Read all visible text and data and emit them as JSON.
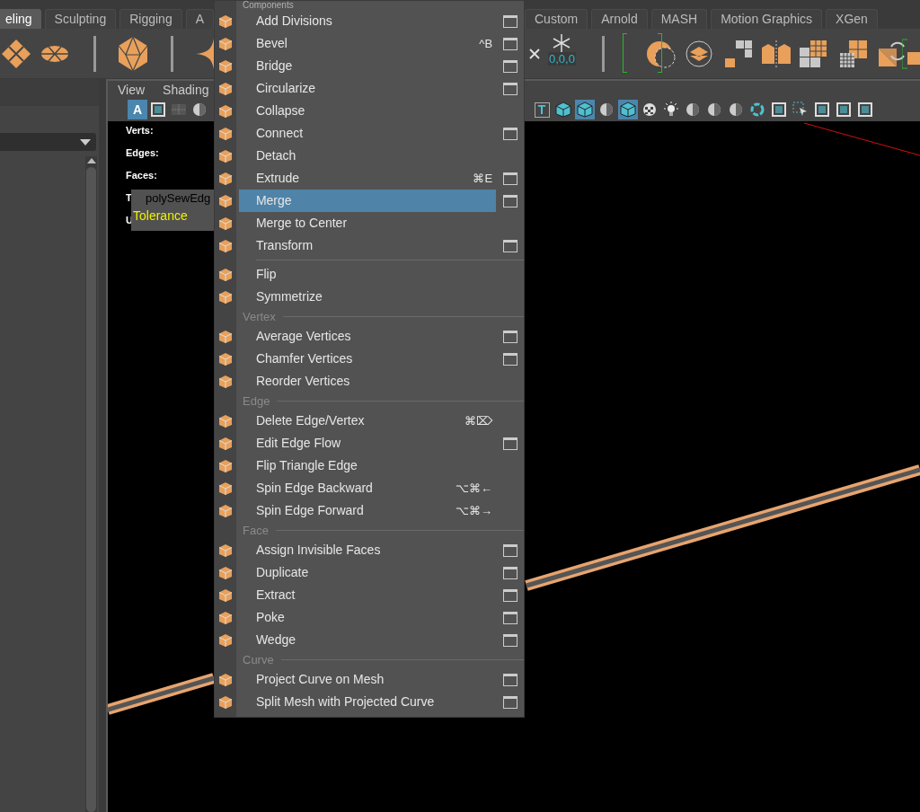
{
  "shelf_tabs_left": [
    {
      "label": "eling",
      "selected": true
    },
    {
      "label": "Sculpting",
      "selected": false
    },
    {
      "label": "Rigging",
      "selected": false
    },
    {
      "label": "A",
      "selected": false
    }
  ],
  "shelf_tabs_right": [
    {
      "label": "Custom",
      "selected": false
    },
    {
      "label": "Arnold",
      "selected": false
    },
    {
      "label": "MASH",
      "selected": false
    },
    {
      "label": "Motion Graphics",
      "selected": false
    },
    {
      "label": "XGen",
      "selected": false
    }
  ],
  "shelf": {
    "coordinate_readout": "0,0,0"
  },
  "viewport_panel": {
    "menus": [
      "View",
      "Shading"
    ],
    "toolbar_left": [
      {
        "kind": "letter",
        "label": "A",
        "selected": true
      },
      {
        "kind": "square",
        "selected": false
      },
      {
        "kind": "grid",
        "selected": false
      },
      {
        "kind": "sphere",
        "selected": false
      }
    ],
    "toolbar_right": [
      {
        "kind": "letter",
        "label": "T",
        "selected": false
      },
      {
        "kind": "cube",
        "selected": false
      },
      {
        "kind": "cube",
        "selected": true
      },
      {
        "kind": "sphere",
        "selected": false
      },
      {
        "kind": "cube",
        "selected": true
      },
      {
        "kind": "checker",
        "selected": false
      },
      {
        "kind": "light",
        "selected": false
      },
      {
        "kind": "sphere",
        "selected": false
      },
      {
        "kind": "sphere",
        "selected": false
      },
      {
        "kind": "sphere",
        "selected": false
      },
      {
        "kind": "ring",
        "selected": false
      },
      {
        "kind": "square",
        "selected": false
      },
      {
        "kind": "select",
        "selected": false
      },
      {
        "kind": "square",
        "selected": false
      },
      {
        "kind": "square",
        "selected": false
      },
      {
        "kind": "square",
        "selected": false
      }
    ]
  },
  "hud": [
    "Verts:",
    "Edges:",
    "Faces:",
    "T",
    "U"
  ],
  "tooltip": {
    "title": "polySewEdg",
    "attribute": "Tolerance"
  },
  "menu": {
    "header": "Components",
    "items": [
      {
        "kind": "item",
        "label": "Add Divisions",
        "option_box": true,
        "selected": false
      },
      {
        "kind": "item",
        "label": "Bevel",
        "shortcut": "^B",
        "option_box": true,
        "selected": false
      },
      {
        "kind": "item",
        "label": "Bridge",
        "option_box": true,
        "selected": false
      },
      {
        "kind": "item",
        "label": "Circularize",
        "option_box": true,
        "selected": false
      },
      {
        "kind": "item",
        "label": "Collapse",
        "option_box": false,
        "selected": false
      },
      {
        "kind": "item",
        "label": "Connect",
        "option_box": true,
        "selected": false
      },
      {
        "kind": "item",
        "label": "Detach",
        "option_box": false,
        "selected": false
      },
      {
        "kind": "item",
        "label": "Extrude",
        "shortcut": "⌘E",
        "option_box": true,
        "selected": false
      },
      {
        "kind": "item",
        "label": "Merge",
        "option_box": true,
        "selected": true
      },
      {
        "kind": "item",
        "label": "Merge to Center",
        "option_box": false,
        "selected": false
      },
      {
        "kind": "item",
        "label": "Transform",
        "option_box": true,
        "selected": false
      },
      {
        "kind": "divider"
      },
      {
        "kind": "item",
        "label": "Flip",
        "option_box": false,
        "selected": false
      },
      {
        "kind": "item",
        "label": "Symmetrize",
        "option_box": false,
        "selected": false
      },
      {
        "kind": "section",
        "label": "Vertex"
      },
      {
        "kind": "item",
        "label": "Average Vertices",
        "option_box": true,
        "selected": false
      },
      {
        "kind": "item",
        "label": "Chamfer Vertices",
        "option_box": true,
        "selected": false
      },
      {
        "kind": "item",
        "label": "Reorder Vertices",
        "option_box": false,
        "selected": false
      },
      {
        "kind": "section",
        "label": "Edge"
      },
      {
        "kind": "item",
        "label": "Delete Edge/Vertex",
        "shortcut": "⌘⌦",
        "option_box": false,
        "selected": false
      },
      {
        "kind": "item",
        "label": "Edit Edge Flow",
        "option_box": true,
        "selected": false
      },
      {
        "kind": "item",
        "label": "Flip Triangle Edge",
        "option_box": false,
        "selected": false
      },
      {
        "kind": "item",
        "label": "Spin Edge Backward",
        "shortcut": "⌥⌘←",
        "option_box": false,
        "selected": false
      },
      {
        "kind": "item",
        "label": "Spin Edge Forward",
        "shortcut": "⌥⌘→",
        "option_box": false,
        "selected": false
      },
      {
        "kind": "section",
        "label": "Face"
      },
      {
        "kind": "item",
        "label": "Assign Invisible Faces",
        "option_box": true,
        "selected": false
      },
      {
        "kind": "item",
        "label": "Duplicate",
        "option_box": true,
        "selected": false
      },
      {
        "kind": "item",
        "label": "Extract",
        "option_box": true,
        "selected": false
      },
      {
        "kind": "item",
        "label": "Poke",
        "option_box": true,
        "selected": false
      },
      {
        "kind": "item",
        "label": "Wedge",
        "option_box": true,
        "selected": false
      },
      {
        "kind": "section",
        "label": "Curve"
      },
      {
        "kind": "item",
        "label": "Project Curve on Mesh",
        "option_box": true,
        "selected": false
      },
      {
        "kind": "item",
        "label": "Split Mesh with Projected Curve",
        "option_box": true,
        "selected": false
      }
    ]
  }
}
